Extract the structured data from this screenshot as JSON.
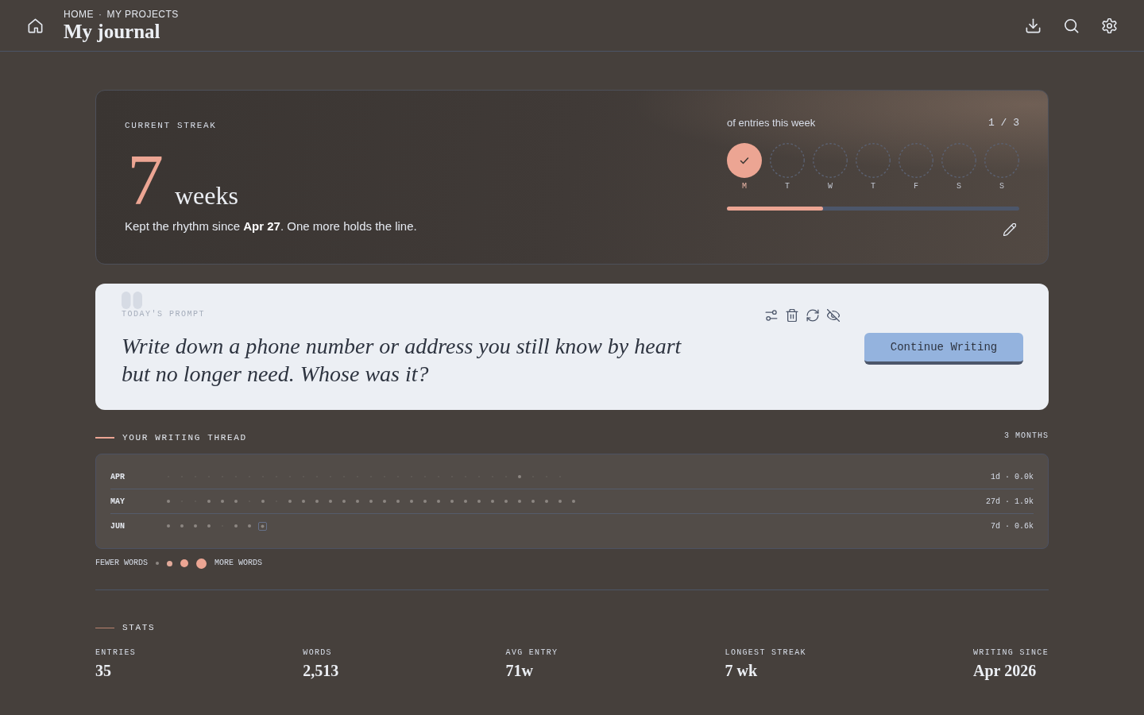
{
  "header": {
    "breadcrumb": [
      {
        "label": "HOME"
      },
      {
        "label": "MY PROJECTS"
      }
    ],
    "separator": "·",
    "title": "My journal"
  },
  "streak": {
    "label": "CURRENT STREAK",
    "count": "7",
    "unit": "weeks",
    "note": "Kept the rhythm since **Apr 27**. One more holds the line.",
    "week": {
      "caption": "of entries this week",
      "progress": "1 / 3",
      "level": 0.33,
      "days": [
        {
          "label": "M",
          "done": true
        },
        {
          "label": "T",
          "done": false
        },
        {
          "label": "W",
          "done": false
        },
        {
          "label": "T",
          "done": false
        },
        {
          "label": "F",
          "done": false
        },
        {
          "label": "S",
          "done": false
        },
        {
          "label": "S",
          "done": false
        }
      ]
    }
  },
  "prompt": {
    "label": "TODAY'S PROMPT",
    "text": "Write down a phone number or address you still know by heart but no longer need. Whose was it?",
    "button": "Continue Writing"
  },
  "thread": {
    "title": "YOUR WRITING THREAD",
    "range": "3 MONTHS",
    "months": [
      {
        "label": "APR",
        "summary": "1d · 0.0k",
        "days": [
          {
            "entry": false,
            "today": false
          },
          {
            "entry": false,
            "today": false
          },
          {
            "entry": false,
            "today": false
          },
          {
            "entry": false,
            "today": false
          },
          {
            "entry": false,
            "today": false
          },
          {
            "entry": false,
            "today": false
          },
          {
            "entry": false,
            "today": false
          },
          {
            "entry": false,
            "today": false
          },
          {
            "entry": false,
            "today": false
          },
          {
            "entry": false,
            "today": false
          },
          {
            "entry": false,
            "today": false
          },
          {
            "entry": false,
            "today": false
          },
          {
            "entry": false,
            "today": false
          },
          {
            "entry": false,
            "today": false
          },
          {
            "entry": false,
            "today": false
          },
          {
            "entry": false,
            "today": false
          },
          {
            "entry": false,
            "today": false
          },
          {
            "entry": false,
            "today": false
          },
          {
            "entry": false,
            "today": false
          },
          {
            "entry": false,
            "today": false
          },
          {
            "entry": false,
            "today": false
          },
          {
            "entry": false,
            "today": false
          },
          {
            "entry": false,
            "today": false
          },
          {
            "entry": false,
            "today": false
          },
          {
            "entry": false,
            "today": false
          },
          {
            "entry": false,
            "today": false
          },
          {
            "entry": true,
            "today": false
          },
          {
            "entry": false,
            "today": false
          },
          {
            "entry": false,
            "today": false
          },
          {
            "entry": false,
            "today": false
          }
        ]
      },
      {
        "label": "MAY",
        "summary": "27d · 1.9k",
        "days": [
          {
            "entry": true,
            "today": false
          },
          {
            "entry": false,
            "today": false
          },
          {
            "entry": false,
            "today": false
          },
          {
            "entry": true,
            "today": false
          },
          {
            "entry": true,
            "today": false
          },
          {
            "entry": true,
            "today": false
          },
          {
            "entry": false,
            "today": false
          },
          {
            "entry": true,
            "today": false
          },
          {
            "entry": false,
            "today": false
          },
          {
            "entry": true,
            "today": false
          },
          {
            "entry": true,
            "today": false
          },
          {
            "entry": true,
            "today": false
          },
          {
            "entry": true,
            "today": false
          },
          {
            "entry": true,
            "today": false
          },
          {
            "entry": true,
            "today": false
          },
          {
            "entry": true,
            "today": false
          },
          {
            "entry": true,
            "today": false
          },
          {
            "entry": true,
            "today": false
          },
          {
            "entry": true,
            "today": false
          },
          {
            "entry": true,
            "today": false
          },
          {
            "entry": true,
            "today": false
          },
          {
            "entry": true,
            "today": false
          },
          {
            "entry": true,
            "today": false
          },
          {
            "entry": true,
            "today": false
          },
          {
            "entry": true,
            "today": false
          },
          {
            "entry": true,
            "today": false
          },
          {
            "entry": true,
            "today": false
          },
          {
            "entry": true,
            "today": false
          },
          {
            "entry": true,
            "today": false
          },
          {
            "entry": true,
            "today": false
          },
          {
            "entry": true,
            "today": false
          }
        ]
      },
      {
        "label": "JUN",
        "summary": "7d · 0.6k",
        "days": [
          {
            "entry": true,
            "today": false
          },
          {
            "entry": true,
            "today": false
          },
          {
            "entry": true,
            "today": false
          },
          {
            "entry": true,
            "today": false
          },
          {
            "entry": false,
            "today": false
          },
          {
            "entry": true,
            "today": false
          },
          {
            "entry": true,
            "today": false
          },
          {
            "entry": true,
            "today": true
          }
        ]
      }
    ],
    "legend": {
      "fewer": "FEWER WORDS",
      "more": "MORE WORDS"
    }
  },
  "stats": {
    "title": "STATS",
    "items": [
      {
        "label": "ENTRIES",
        "value": "35"
      },
      {
        "label": "WORDS",
        "value": "2,513"
      },
      {
        "label": "AVG ENTRY",
        "value": "71w"
      },
      {
        "label": "LONGEST STREAK",
        "value": "7 wk"
      },
      {
        "label": "WRITING SINCE",
        "value": "Apr 2026"
      }
    ]
  }
}
